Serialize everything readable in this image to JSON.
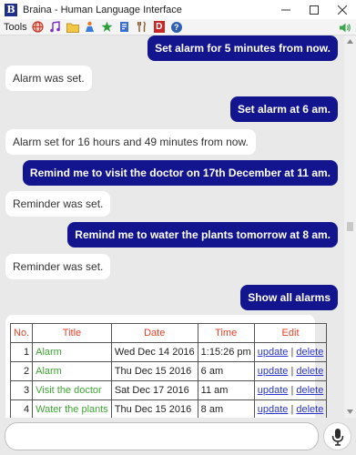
{
  "window": {
    "title": "Braina - Human Language Interface",
    "app_icon_letter": "B",
    "controls": [
      "minimize",
      "maximize",
      "close"
    ]
  },
  "toolbar": {
    "label": "Tools",
    "icons": [
      "globe-icon",
      "music-icon",
      "folder-icon",
      "person-icon",
      "star-icon",
      "bookmark-icon",
      "utensils-icon",
      "dictionary-icon",
      "help-icon"
    ],
    "dictionary_letter": "D",
    "help_glyph": "?",
    "speaker_icon": "speaker-icon"
  },
  "messages": [
    {
      "role": "user",
      "text": "Set alarm for 5 minutes from now."
    },
    {
      "role": "bot",
      "text": "Alarm was set."
    },
    {
      "role": "user",
      "text": "Set alarm at 6 am."
    },
    {
      "role": "bot",
      "text": "Alarm set for 16 hours and 49 minutes from now."
    },
    {
      "role": "user",
      "text": "Remind me to visit the doctor on 17th December at 11 am."
    },
    {
      "role": "bot",
      "text": "Reminder was set."
    },
    {
      "role": "user",
      "text": "Remind me to water the plants tomorrow at 8 am."
    },
    {
      "role": "bot",
      "text": "Reminder was set."
    },
    {
      "role": "user",
      "text": "Show all alarms"
    }
  ],
  "alarm_table": {
    "headers": [
      "No.",
      "Title",
      "Date",
      "Time",
      "Edit"
    ],
    "rows": [
      {
        "no": "1",
        "title": "Alarm",
        "date": "Wed Dec 14 2016",
        "time": "1:15:26 pm",
        "update": "update",
        "sep": "|",
        "delete": "delete"
      },
      {
        "no": "2",
        "title": "Alarm",
        "date": "Thu Dec 15 2016",
        "time": "6 am",
        "update": "update",
        "sep": "|",
        "delete": "delete"
      },
      {
        "no": "3",
        "title": "Visit the doctor",
        "date": "Sat Dec 17 2016",
        "time": "11 am",
        "update": "update",
        "sep": "|",
        "delete": "delete"
      },
      {
        "no": "4",
        "title": "Water the plants",
        "date": "Thu Dec 15 2016",
        "time": "8 am",
        "update": "update",
        "sep": "|",
        "delete": "delete"
      }
    ]
  },
  "input": {
    "value": "",
    "placeholder": ""
  },
  "colors": {
    "user_bubble": "#13158f",
    "bot_bubble": "#ffffff",
    "table_header": "#e2432a",
    "table_title": "#3fa535",
    "link": "#2a35c8",
    "background": "#e9e9e9"
  }
}
